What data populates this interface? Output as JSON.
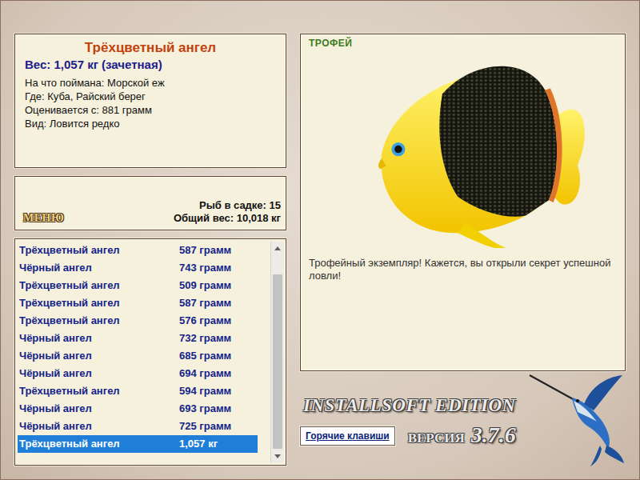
{
  "fish": {
    "name": "Трёхцветный ангел",
    "weight": "Вес: 1,057 кг (зачетная)",
    "details": [
      "На что поймана: Морской еж",
      "Где: Куба, Райский берег",
      "Оценивается с: 881 грамм",
      "Вид: Ловится редко"
    ]
  },
  "keepnet": {
    "menu": "МЕНЮ",
    "count": "Рыб в садке: 15",
    "total": "Общий вес: 10,018 кг"
  },
  "catch_list": {
    "scrollbar": {
      "level": 0.9
    },
    "rows": [
      {
        "name": "Трёхцветный ангел",
        "weight": "587 грамм",
        "selected": false
      },
      {
        "name": "Чёрный ангел",
        "weight": "743 грамм",
        "selected": false
      },
      {
        "name": "Трёхцветный ангел",
        "weight": "509 грамм",
        "selected": false
      },
      {
        "name": "Трёхцветный ангел",
        "weight": "587 грамм",
        "selected": false
      },
      {
        "name": "Трёхцветный ангел",
        "weight": "576 грамм",
        "selected": false
      },
      {
        "name": "Чёрный ангел",
        "weight": "732 грамм",
        "selected": false
      },
      {
        "name": "Чёрный ангел",
        "weight": "685 грамм",
        "selected": false
      },
      {
        "name": "Чёрный ангел",
        "weight": "694 грамм",
        "selected": false
      },
      {
        "name": "Трёхцветный ангел",
        "weight": "594 грамм",
        "selected": false
      },
      {
        "name": "Чёрный ангел",
        "weight": "693 грамм",
        "selected": false
      },
      {
        "name": "Чёрный ангел",
        "weight": "725 грамм",
        "selected": false
      },
      {
        "name": "Трёхцветный ангел",
        "weight": "1,057 кг",
        "selected": true
      }
    ]
  },
  "trophy": {
    "badge": "ТРОФЕЙ",
    "message": "Трофейный экземпляр! Кажется, вы открыли секрет успешной ловли!"
  },
  "footer": {
    "edition": "INSTALLSOFT EDITION",
    "version_label": "ВЕРСИЯ",
    "version": "3.7.6",
    "hotkeys": "Горячие клавиши"
  }
}
